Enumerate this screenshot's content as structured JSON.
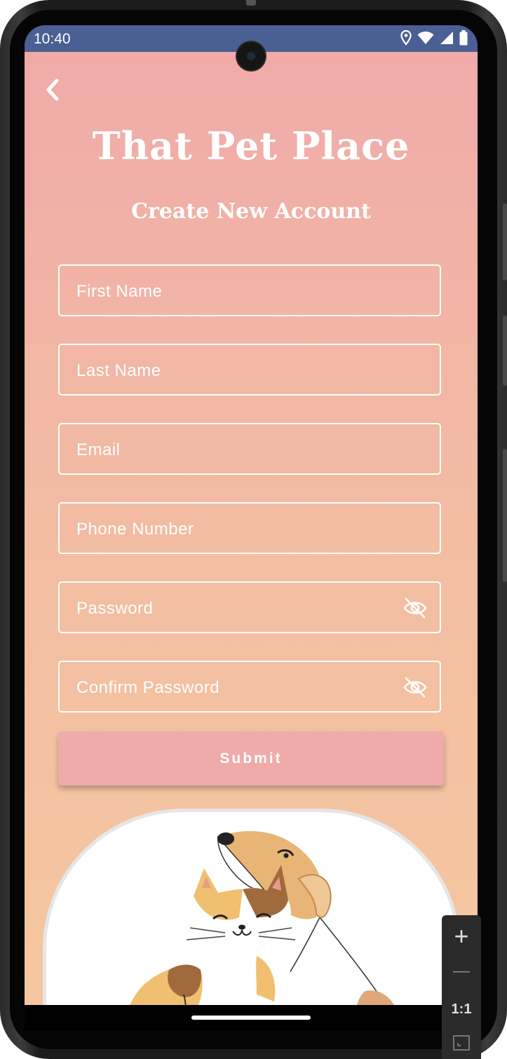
{
  "status_bar": {
    "time": "10:40",
    "icons": [
      "location-icon",
      "wifi-icon",
      "signal-icon",
      "battery-icon"
    ]
  },
  "header": {
    "back_icon": "chevron-left-icon",
    "app_title": "That Pet Place",
    "subtitle": "Create New Account"
  },
  "form": {
    "fields": [
      {
        "label": "First Name",
        "has_eye": false
      },
      {
        "label": "Last Name",
        "has_eye": false
      },
      {
        "label": "Email",
        "has_eye": false
      },
      {
        "label": "Phone Number",
        "has_eye": false
      },
      {
        "label": "Password",
        "has_eye": true
      },
      {
        "label": "Confirm Password",
        "has_eye": true
      }
    ],
    "submit_label": "Submit"
  },
  "zoom_controls": {
    "zoom_in": "+",
    "zoom_out": "—",
    "actual_size": "1:1"
  },
  "colors": {
    "status_bar": "#4a5f94",
    "gradient_top": "#f0aaa9",
    "gradient_bottom": "#f5c8a0",
    "submit": "#eeabaa"
  }
}
